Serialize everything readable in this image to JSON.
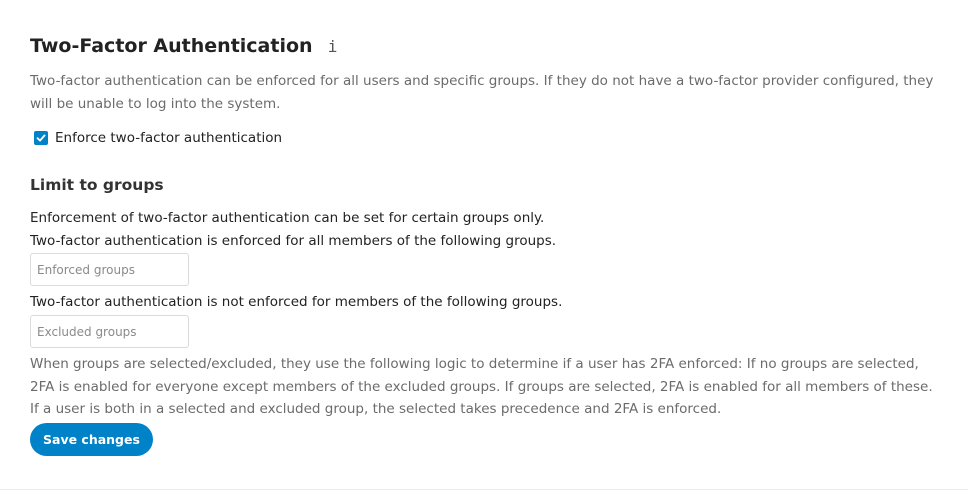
{
  "section": {
    "title": "Two-Factor Authentication",
    "info_icon": "i",
    "description": "Two-factor authentication can be enforced for all users and specific groups. If they do not have a two-factor provider configured, they will be unable to log into the system."
  },
  "enforce": {
    "label": "Enforce two-factor authentication",
    "checked": true
  },
  "groups": {
    "heading": "Limit to groups",
    "intro": "Enforcement of two-factor authentication can be set for certain groups only.",
    "enforced_label": "Two-factor authentication is enforced for all members of the following groups.",
    "enforced_placeholder": "Enforced groups",
    "excluded_label": "Two-factor authentication is not enforced for members of the following groups.",
    "excluded_placeholder": "Excluded groups",
    "logic_text": "When groups are selected/excluded, they use the following logic to determine if a user has 2FA enforced: If no groups are selected, 2FA is enabled for everyone except members of the excluded groups. If groups are selected, 2FA is enabled for all members of these. If a user is both in a selected and excluded group, the selected takes precedence and 2FA is enforced."
  },
  "actions": {
    "save_label": "Save changes"
  },
  "colors": {
    "primary": "#0082c9",
    "muted_text": "#6b6b6b"
  }
}
